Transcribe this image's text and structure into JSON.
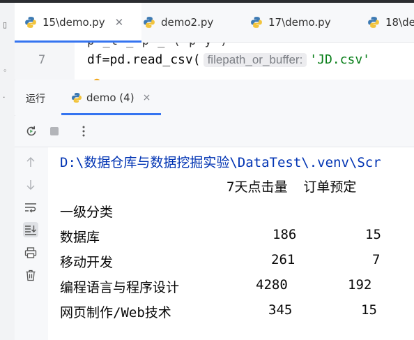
{
  "editor_tabs": [
    {
      "label": "15\\demo.py",
      "active": true,
      "closable": true
    },
    {
      "label": "demo2.py",
      "active": false
    },
    {
      "label": "17\\demo.py",
      "active": false
    },
    {
      "label": "18\\de",
      "active": false
    }
  ],
  "editor": {
    "line_number": "7",
    "clipped_above": "p  _t _ p  _    (  p  y    )",
    "code_prefix": "df=pd.read_csv(",
    "param_hint": "filepath_or_buffer:",
    "string_arg": "'JD.csv'"
  },
  "run_panel": {
    "label": "运行",
    "tab_label": "demo (4)",
    "tab_close": "×"
  },
  "console": {
    "path_line": "D:\\数据仓库与数据挖掘实验\\DataTest\\.venv\\Scr",
    "header": "7天点击量  订单预定",
    "index_name": "一级分类",
    "rows": [
      {
        "name": "数据库",
        "clicks": "186",
        "orders": "15"
      },
      {
        "name": "移动开发",
        "clicks": "261",
        "orders": "7"
      },
      {
        "name": "编程语言与程序设计",
        "clicks": "4280",
        "orders": "192"
      },
      {
        "name": "网页制作/Web技术",
        "clicks": "345",
        "orders": "15"
      }
    ]
  },
  "colors": {
    "accent": "#3574f0",
    "path_blue": "#0033b3",
    "string_green": "#067d17",
    "python_blue": "#3d7ab3",
    "python_yellow": "#f2c43d"
  },
  "icons": {
    "tab_icon": "python-icon",
    "toolbar": [
      "rerun-icon",
      "stop-icon",
      "more-icon"
    ],
    "side": [
      "arrow-up-icon",
      "arrow-down-icon",
      "soft-wrap-icon",
      "scroll-to-end-icon",
      "print-icon",
      "trash-icon"
    ]
  }
}
